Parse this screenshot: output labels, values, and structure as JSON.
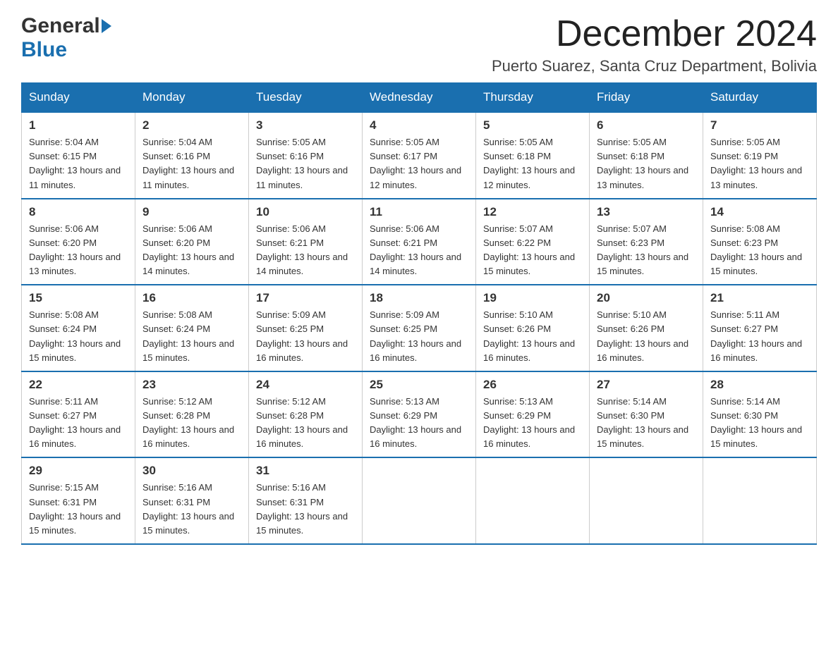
{
  "header": {
    "logo_general": "General",
    "logo_blue": "Blue",
    "month_title": "December 2024",
    "location": "Puerto Suarez, Santa Cruz Department, Bolivia"
  },
  "days_of_week": [
    "Sunday",
    "Monday",
    "Tuesday",
    "Wednesday",
    "Thursday",
    "Friday",
    "Saturday"
  ],
  "weeks": [
    [
      {
        "day": "1",
        "sunrise": "Sunrise: 5:04 AM",
        "sunset": "Sunset: 6:15 PM",
        "daylight": "Daylight: 13 hours and 11 minutes."
      },
      {
        "day": "2",
        "sunrise": "Sunrise: 5:04 AM",
        "sunset": "Sunset: 6:16 PM",
        "daylight": "Daylight: 13 hours and 11 minutes."
      },
      {
        "day": "3",
        "sunrise": "Sunrise: 5:05 AM",
        "sunset": "Sunset: 6:16 PM",
        "daylight": "Daylight: 13 hours and 11 minutes."
      },
      {
        "day": "4",
        "sunrise": "Sunrise: 5:05 AM",
        "sunset": "Sunset: 6:17 PM",
        "daylight": "Daylight: 13 hours and 12 minutes."
      },
      {
        "day": "5",
        "sunrise": "Sunrise: 5:05 AM",
        "sunset": "Sunset: 6:18 PM",
        "daylight": "Daylight: 13 hours and 12 minutes."
      },
      {
        "day": "6",
        "sunrise": "Sunrise: 5:05 AM",
        "sunset": "Sunset: 6:18 PM",
        "daylight": "Daylight: 13 hours and 13 minutes."
      },
      {
        "day": "7",
        "sunrise": "Sunrise: 5:05 AM",
        "sunset": "Sunset: 6:19 PM",
        "daylight": "Daylight: 13 hours and 13 minutes."
      }
    ],
    [
      {
        "day": "8",
        "sunrise": "Sunrise: 5:06 AM",
        "sunset": "Sunset: 6:20 PM",
        "daylight": "Daylight: 13 hours and 13 minutes."
      },
      {
        "day": "9",
        "sunrise": "Sunrise: 5:06 AM",
        "sunset": "Sunset: 6:20 PM",
        "daylight": "Daylight: 13 hours and 14 minutes."
      },
      {
        "day": "10",
        "sunrise": "Sunrise: 5:06 AM",
        "sunset": "Sunset: 6:21 PM",
        "daylight": "Daylight: 13 hours and 14 minutes."
      },
      {
        "day": "11",
        "sunrise": "Sunrise: 5:06 AM",
        "sunset": "Sunset: 6:21 PM",
        "daylight": "Daylight: 13 hours and 14 minutes."
      },
      {
        "day": "12",
        "sunrise": "Sunrise: 5:07 AM",
        "sunset": "Sunset: 6:22 PM",
        "daylight": "Daylight: 13 hours and 15 minutes."
      },
      {
        "day": "13",
        "sunrise": "Sunrise: 5:07 AM",
        "sunset": "Sunset: 6:23 PM",
        "daylight": "Daylight: 13 hours and 15 minutes."
      },
      {
        "day": "14",
        "sunrise": "Sunrise: 5:08 AM",
        "sunset": "Sunset: 6:23 PM",
        "daylight": "Daylight: 13 hours and 15 minutes."
      }
    ],
    [
      {
        "day": "15",
        "sunrise": "Sunrise: 5:08 AM",
        "sunset": "Sunset: 6:24 PM",
        "daylight": "Daylight: 13 hours and 15 minutes."
      },
      {
        "day": "16",
        "sunrise": "Sunrise: 5:08 AM",
        "sunset": "Sunset: 6:24 PM",
        "daylight": "Daylight: 13 hours and 15 minutes."
      },
      {
        "day": "17",
        "sunrise": "Sunrise: 5:09 AM",
        "sunset": "Sunset: 6:25 PM",
        "daylight": "Daylight: 13 hours and 16 minutes."
      },
      {
        "day": "18",
        "sunrise": "Sunrise: 5:09 AM",
        "sunset": "Sunset: 6:25 PM",
        "daylight": "Daylight: 13 hours and 16 minutes."
      },
      {
        "day": "19",
        "sunrise": "Sunrise: 5:10 AM",
        "sunset": "Sunset: 6:26 PM",
        "daylight": "Daylight: 13 hours and 16 minutes."
      },
      {
        "day": "20",
        "sunrise": "Sunrise: 5:10 AM",
        "sunset": "Sunset: 6:26 PM",
        "daylight": "Daylight: 13 hours and 16 minutes."
      },
      {
        "day": "21",
        "sunrise": "Sunrise: 5:11 AM",
        "sunset": "Sunset: 6:27 PM",
        "daylight": "Daylight: 13 hours and 16 minutes."
      }
    ],
    [
      {
        "day": "22",
        "sunrise": "Sunrise: 5:11 AM",
        "sunset": "Sunset: 6:27 PM",
        "daylight": "Daylight: 13 hours and 16 minutes."
      },
      {
        "day": "23",
        "sunrise": "Sunrise: 5:12 AM",
        "sunset": "Sunset: 6:28 PM",
        "daylight": "Daylight: 13 hours and 16 minutes."
      },
      {
        "day": "24",
        "sunrise": "Sunrise: 5:12 AM",
        "sunset": "Sunset: 6:28 PM",
        "daylight": "Daylight: 13 hours and 16 minutes."
      },
      {
        "day": "25",
        "sunrise": "Sunrise: 5:13 AM",
        "sunset": "Sunset: 6:29 PM",
        "daylight": "Daylight: 13 hours and 16 minutes."
      },
      {
        "day": "26",
        "sunrise": "Sunrise: 5:13 AM",
        "sunset": "Sunset: 6:29 PM",
        "daylight": "Daylight: 13 hours and 16 minutes."
      },
      {
        "day": "27",
        "sunrise": "Sunrise: 5:14 AM",
        "sunset": "Sunset: 6:30 PM",
        "daylight": "Daylight: 13 hours and 15 minutes."
      },
      {
        "day": "28",
        "sunrise": "Sunrise: 5:14 AM",
        "sunset": "Sunset: 6:30 PM",
        "daylight": "Daylight: 13 hours and 15 minutes."
      }
    ],
    [
      {
        "day": "29",
        "sunrise": "Sunrise: 5:15 AM",
        "sunset": "Sunset: 6:31 PM",
        "daylight": "Daylight: 13 hours and 15 minutes."
      },
      {
        "day": "30",
        "sunrise": "Sunrise: 5:16 AM",
        "sunset": "Sunset: 6:31 PM",
        "daylight": "Daylight: 13 hours and 15 minutes."
      },
      {
        "day": "31",
        "sunrise": "Sunrise: 5:16 AM",
        "sunset": "Sunset: 6:31 PM",
        "daylight": "Daylight: 13 hours and 15 minutes."
      },
      null,
      null,
      null,
      null
    ]
  ]
}
